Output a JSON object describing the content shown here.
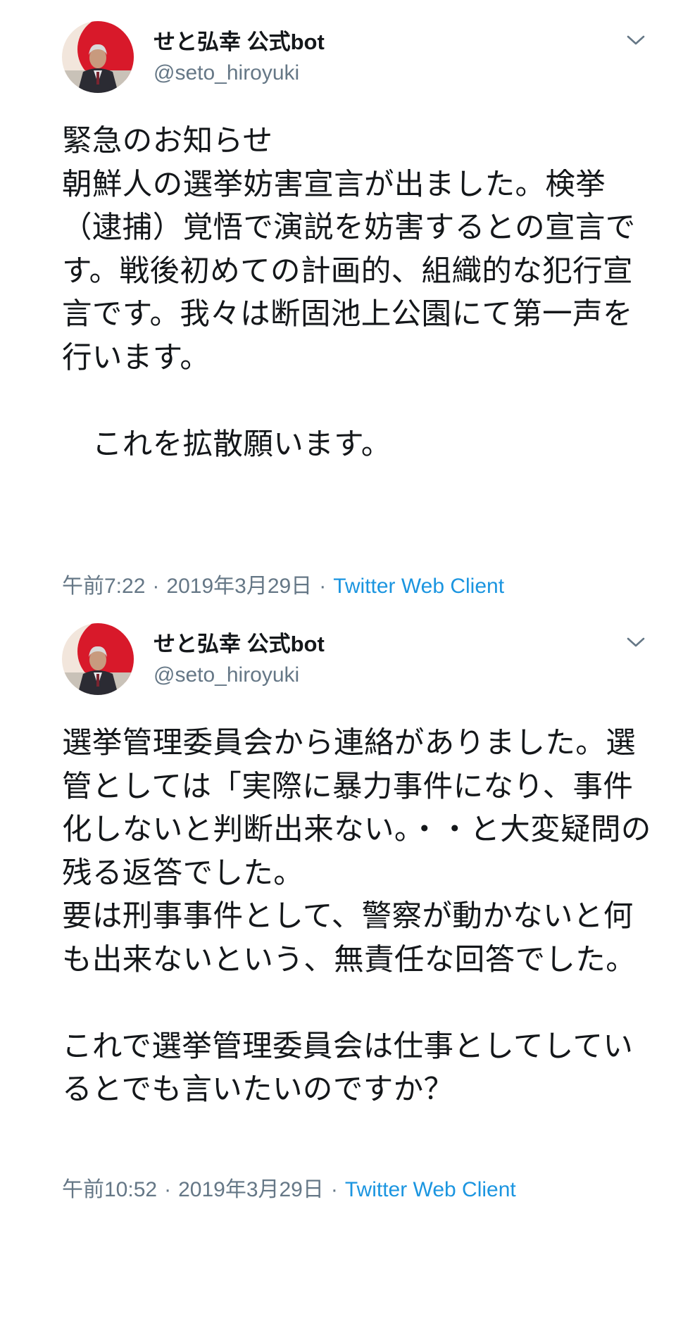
{
  "tweets": [
    {
      "author": {
        "display_name": "せと弘幸 公式bot",
        "handle": "@seto_hiroyuki"
      },
      "text": "緊急のお知らせ\n朝鮮人の選挙妨害宣言が出ました。検挙（逮捕）覚悟で演説を妨害するとの宣言です。戦後初めての計画的、組織的な犯行宣言です。我々は断固池上公園にて第一声を行います。\n\n　これを拡散願います。",
      "time": "午前7:22",
      "date": "2019年3月29日",
      "client": "Twitter Web Client"
    },
    {
      "author": {
        "display_name": "せと弘幸 公式bot",
        "handle": "@seto_hiroyuki"
      },
      "text": "選挙管理委員会から連絡がありました。選管としては「実際に暴力事件になり、事件化しないと判断出来ない。・・と大変疑問の残る返答でした。\n要は刑事事件として、警察が動かないと何も出来ないという、無責任な回答でした。\n\nこれで選挙管理委員会は仕事としてしているとでも言いたいのですか？",
      "time": "午前10:52",
      "date": "2019年3月29日",
      "client": "Twitter Web Client"
    }
  ],
  "icons": {
    "avatar": "profile-photo",
    "menu": "chevron-down-icon"
  },
  "colors": {
    "link": "#1b95e0",
    "secondary": "#657786",
    "text": "#14171a",
    "avatar_bg": "#d8192a"
  }
}
